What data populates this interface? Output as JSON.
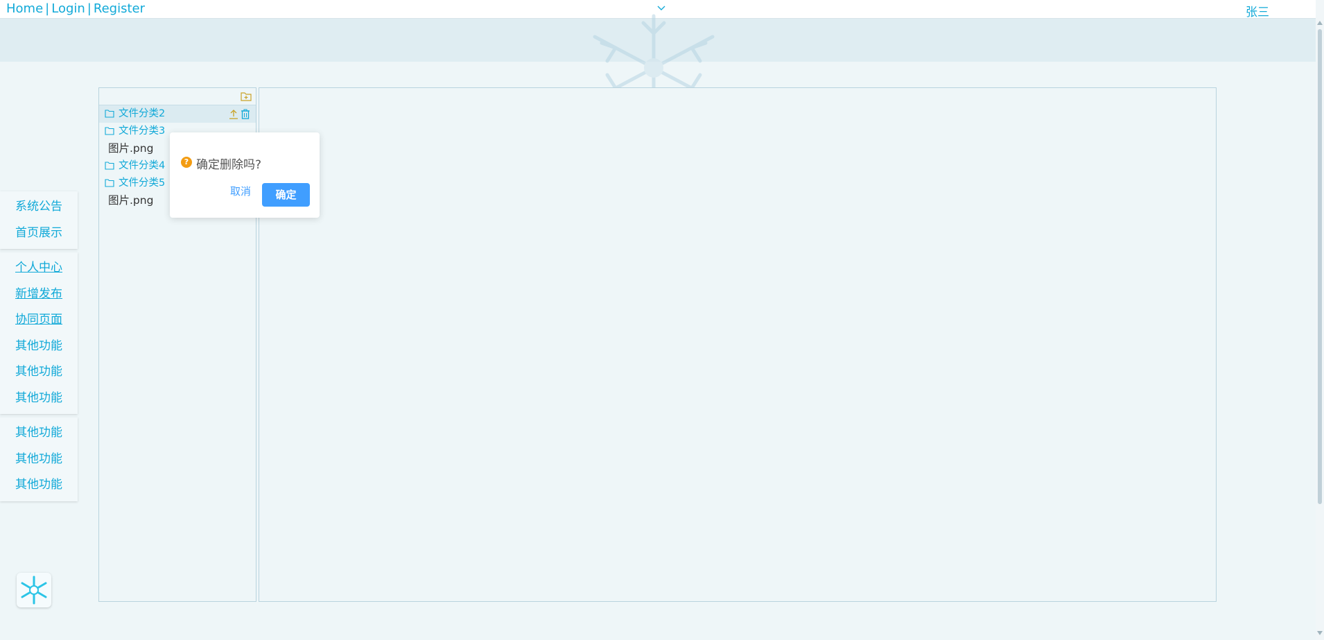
{
  "topnav": {
    "home": "Home",
    "login": "Login",
    "register": "Register",
    "sep": "|"
  },
  "user": {
    "name": "张三"
  },
  "sidebar": {
    "groups": [
      [
        "系统公告",
        "首页展示"
      ],
      [
        "个人中心",
        "新增发布",
        "协同页面",
        "其他功能",
        "其他功能",
        "其他功能"
      ],
      [
        "其他功能",
        "其他功能",
        "其他功能"
      ]
    ]
  },
  "tree": {
    "rows": [
      {
        "type": "folder",
        "label": "文件分类2",
        "selected": true
      },
      {
        "type": "folder",
        "label": "文件分类3"
      },
      {
        "type": "file",
        "label": "图片.png"
      },
      {
        "type": "folder",
        "label": "文件分类4"
      },
      {
        "type": "folder",
        "label": "文件分类5"
      },
      {
        "type": "file",
        "label": "图片.png"
      }
    ]
  },
  "confirm": {
    "message": "确定删除吗?",
    "cancel": "取消",
    "ok": "确定",
    "icon": "?"
  },
  "colors": {
    "accent": "#11a9d8",
    "primary": "#409eff",
    "warning": "#f39c12",
    "actionIcon": "#c9a227"
  }
}
